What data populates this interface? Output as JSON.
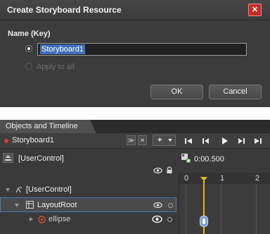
{
  "dialog": {
    "title": "Create Storyboard Resource",
    "close_glyph": "✕",
    "name_label": "Name (Key)",
    "name_value": "Storyboard1",
    "apply_label": "Apply to all",
    "ok_label": "OK",
    "cancel_label": "Cancel"
  },
  "panel": {
    "tab_label": "Objects and Timeline",
    "storyboard_name": "Storyboard1",
    "expand_glyph": "≫",
    "close_glyph": "✕",
    "add_glyph": "+",
    "scope_label": "[UserControl]",
    "time_value": "0:00.500",
    "tree": [
      {
        "label": "[UserControl]",
        "expanded": true
      },
      {
        "label": "LayoutRoot",
        "expanded": true
      },
      {
        "label": "ellipse",
        "expanded": false
      }
    ],
    "ruler_ticks": [
      "0",
      "1",
      "2"
    ]
  },
  "colors": {
    "accent": "#4d78b8",
    "close": "#c62d28",
    "playhead": "#e6b800"
  },
  "icons": [
    "close-icon",
    "radio-icon",
    "playback-first-icon",
    "playback-prev-icon",
    "play-icon",
    "playback-next-icon",
    "playback-last-icon",
    "eye-icon",
    "lock-icon",
    "keyframe-add-icon",
    "user-control-icon",
    "grid-icon",
    "ellipse-icon"
  ]
}
